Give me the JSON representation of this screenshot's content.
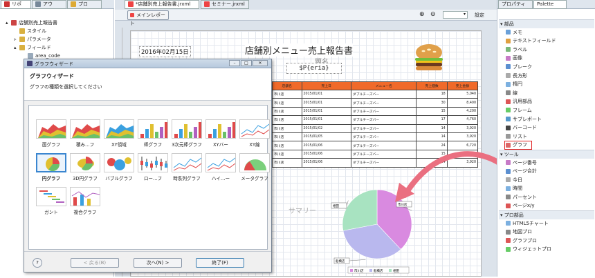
{
  "left_panel": {
    "tabs": [
      "リポ",
      "アウ",
      "プロ"
    ],
    "tree": [
      {
        "label": "店舗別売上報告書",
        "level": 0,
        "twisty": "▴"
      },
      {
        "label": "スタイル",
        "level": 1,
        "twisty": ""
      },
      {
        "label": "パラメータ",
        "level": 1,
        "twisty": "▹"
      },
      {
        "label": "フィールド",
        "level": 1,
        "twisty": "▴"
      },
      {
        "label": "area_code",
        "level": 2,
        "twisty": ""
      }
    ]
  },
  "editor": {
    "tabs": [
      "*店舗別売上報告書.jrxml",
      "セミナー.jrxml"
    ],
    "toolbar_button": "メインレポート",
    "settings_label": "設定"
  },
  "report": {
    "date": "2016年02月15日",
    "title": "店舗別メニュー売上報告書",
    "param_label": "題名",
    "param": "$P{eria}",
    "summary": "サマリー",
    "columns": [
      "店舗名",
      "売上日",
      "メニュー名",
      "売上個数",
      "売上金額"
    ],
    "rows": [
      [
        "市川店",
        "2015/01/01",
        "ダブルチーズバー",
        "18",
        "5,040"
      ],
      [
        "市川店",
        "2015/01/01",
        "ダブルチーズバー",
        "30",
        "8,400"
      ],
      [
        "市川店",
        "2015/01/01",
        "ダブルチーズバー",
        "15",
        "4,200"
      ],
      [
        "市川店",
        "2015/01/01",
        "ダブルチーズバー",
        "17",
        "4,760"
      ],
      [
        "市川店",
        "2015/01/02",
        "ダブルチーズバー",
        "14",
        "3,920"
      ],
      [
        "市川店",
        "2015/01/05",
        "ダブルチーズバー",
        "14",
        "3,920"
      ],
      [
        "市川店",
        "2015/01/06",
        "ダブルチーズバー",
        "24",
        "6,720"
      ],
      [
        "市川店",
        "2015/01/06",
        "ダブルチーズバー",
        "15",
        "4,200"
      ],
      [
        "市川店",
        "2015/01/06",
        "ダブルチーズバー",
        "14",
        "3,920"
      ]
    ]
  },
  "chart_data": {
    "type": "pie",
    "series": [
      {
        "values": [
          38,
          34,
          28
        ]
      }
    ],
    "categories": [
      "市川店",
      "船橋店",
      "相田"
    ],
    "colors": [
      "#d98ae0",
      "#b9b8ee",
      "#a8e3c1"
    ]
  },
  "palette": {
    "tabs": [
      "プロパティ",
      "Palette"
    ],
    "sections": [
      {
        "title": "部品",
        "items": [
          "メモ",
          "テキストフィールド",
          "ラベル",
          "画像",
          "ブレーク",
          "長方形",
          "楕円",
          "線",
          "汎用部品",
          "フレーム",
          "サブレポート",
          "バーコード",
          "リスト",
          "グラフ"
        ]
      },
      {
        "title": "ツール",
        "items": [
          "ページ番号",
          "ページ合計",
          "今日",
          "時間",
          "パーセント",
          "ページx/y"
        ]
      },
      {
        "title": "プロ部品",
        "items": [
          "HTML5チャート",
          "地図プロ",
          "グラフプロ",
          "ウィジェットプロ"
        ]
      }
    ]
  },
  "wizard": {
    "window_title": "グラフウィザード",
    "heading": "グラフウィザード",
    "subtitle": "グラフの種類を選択してください",
    "charts": [
      "面グラフ",
      "積み…フ",
      "XY領域",
      "棒グラフ",
      "3次元棒グラフ",
      "XYバー",
      "XY線",
      "円グラフ",
      "3D円グラフ",
      "バブルグラフ",
      "ロー…フ",
      "時系列グラフ",
      "ハイ…ー",
      "メータグラフ",
      "ガント",
      "複合グラフ"
    ],
    "selected": "円グラフ",
    "buttons": {
      "help": "?",
      "back": "< 戻る(B)",
      "next": "次へ(N) >",
      "finish": "終了(F)"
    }
  }
}
